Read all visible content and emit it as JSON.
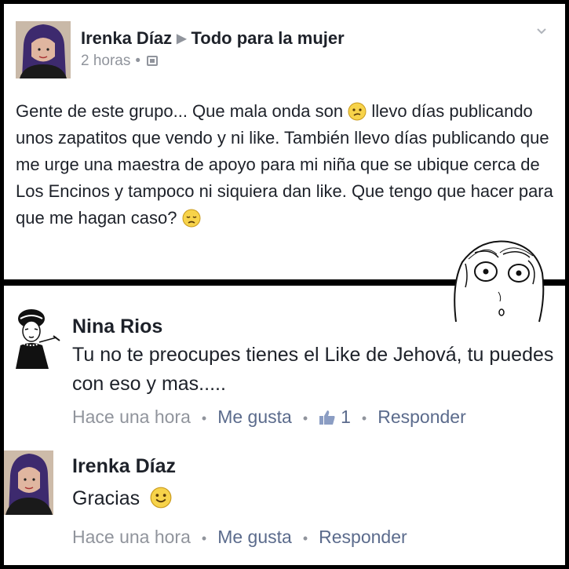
{
  "post": {
    "author": "Irenka Díaz",
    "group": "Todo para la mujer",
    "time": "2 horas",
    "body_part1": "Gente de este grupo... Que mala onda son",
    "body_part2": "llevo días publicando unos zapatitos que vendo y ni like. También llevo días publicando que me urge una maestra de apoyo para mi niña que se ubique cerca de Los Encinos y tampoco ni siquiera dan like. Que tengo que hacer para que me hagan caso?",
    "icons": [
      "chevron-down-icon",
      "group-privacy-icon",
      "confused-emoji-icon",
      "sad-emoji-icon"
    ]
  },
  "comments": [
    {
      "author": "Nina Rios",
      "text": "Tu no te preocupes tienes el Like de Jehová, tu puedes con eso y mas.....",
      "time": "Hace una hora",
      "like_label": "Me gusta",
      "like_count": "1",
      "reply_label": "Responder"
    },
    {
      "author": "Irenka Díaz",
      "text": "Gracias",
      "time": "Hace una hora",
      "like_label": "Me gusta",
      "reply_label": "Responder"
    }
  ],
  "colors": {
    "text": "#1d2129",
    "meta": "#90949c",
    "link": "#5b6b8c",
    "background": "#ffffff",
    "frame": "#000000"
  }
}
